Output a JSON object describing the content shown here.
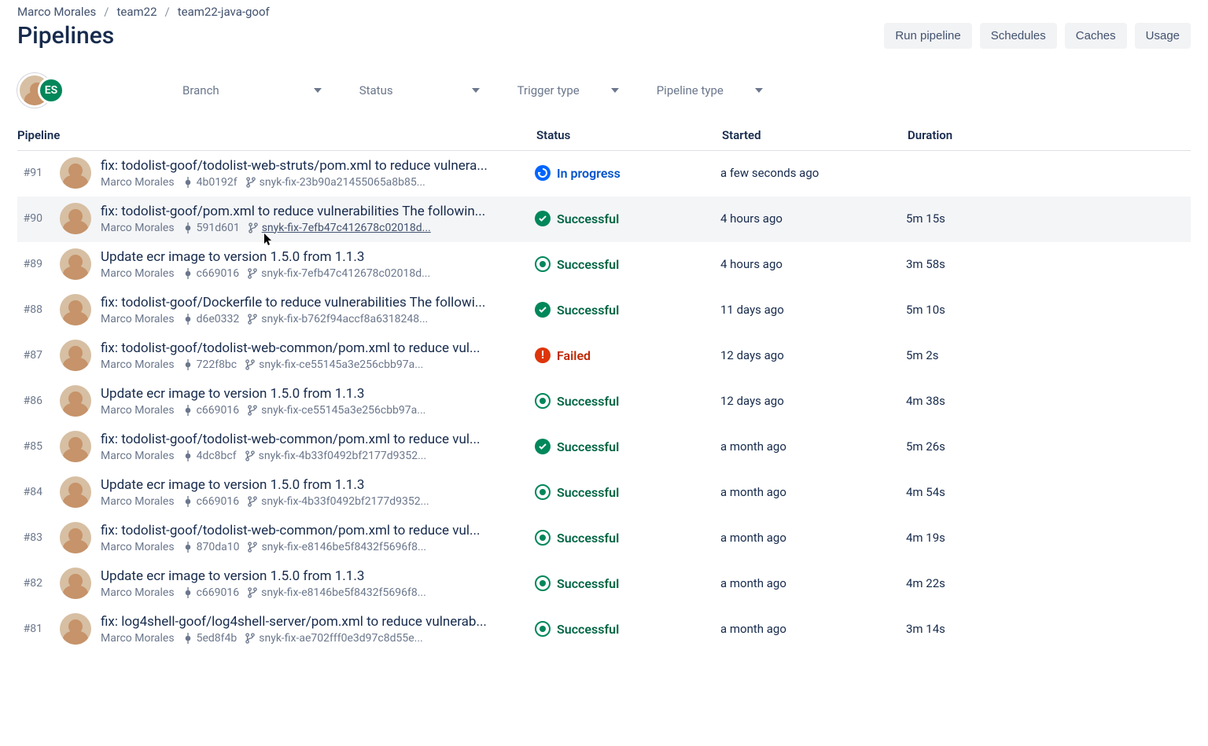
{
  "breadcrumbs": {
    "a": "Marco Morales",
    "b": "team22",
    "c": "team22-java-goof"
  },
  "page_title": "Pipelines",
  "header_actions": {
    "run": "Run pipeline",
    "schedules": "Schedules",
    "caches": "Caches",
    "usage": "Usage"
  },
  "filters": {
    "branch": "Branch",
    "status": "Status",
    "trigger": "Trigger type",
    "pipeline_type": "Pipeline type"
  },
  "avatar_badge": "ES",
  "columns": {
    "pipeline": "Pipeline",
    "status": "Status",
    "started": "Started",
    "duration": "Duration"
  },
  "status_labels": {
    "in_progress": "In progress",
    "successful": "Successful",
    "failed": "Failed"
  },
  "rows": [
    {
      "num": "#91",
      "title": "fix: todolist-goof/todolist-web-struts/pom.xml to reduce vulnera...",
      "author": "Marco Morales",
      "commit": "4b0192f",
      "branch": "snyk-fix-23b90a21455065a8b85...",
      "status": "in_progress",
      "status_style": "prog",
      "started": "a few seconds ago",
      "duration": ""
    },
    {
      "num": "#90",
      "title": "fix: todolist-goof/pom.xml to reduce vulnerabilities The followin...",
      "author": "Marco Morales",
      "commit": "591d601",
      "branch": " snyk-fix-7efb47c412678c02018d...",
      "branch_linked": true,
      "status": "successful",
      "status_style": "filled",
      "started": "4 hours ago",
      "duration": "5m 15s",
      "hovered": true
    },
    {
      "num": "#89",
      "title": "Update ecr image to version 1.5.0 from 1.1.3",
      "author": "Marco Morales",
      "commit": "c669016",
      "branch": "snyk-fix-7efb47c412678c02018d...",
      "status": "successful",
      "status_style": "ring",
      "started": "4 hours ago",
      "duration": "3m 58s"
    },
    {
      "num": "#88",
      "title": "fix: todolist-goof/Dockerfile to reduce vulnerabilities The followi...",
      "author": "Marco Morales",
      "commit": "d6e0332",
      "branch": "snyk-fix-b762f94accf8a6318248...",
      "status": "successful",
      "status_style": "filled",
      "started": "11 days ago",
      "duration": "5m 10s"
    },
    {
      "num": "#87",
      "title": "fix: todolist-goof/todolist-web-common/pom.xml to reduce vul...",
      "author": "Marco Morales",
      "commit": "722f8bc",
      "branch": "snyk-fix-ce55145a3e256cbb97a...",
      "status": "failed",
      "status_style": "fail",
      "started": "12 days ago",
      "duration": "5m 2s"
    },
    {
      "num": "#86",
      "title": "Update ecr image to version 1.5.0 from 1.1.3",
      "author": "Marco Morales",
      "commit": "c669016",
      "branch": "snyk-fix-ce55145a3e256cbb97a...",
      "status": "successful",
      "status_style": "ring",
      "started": "12 days ago",
      "duration": "4m 38s"
    },
    {
      "num": "#85",
      "title": "fix: todolist-goof/todolist-web-common/pom.xml to reduce vul...",
      "author": "Marco Morales",
      "commit": "4dc8bcf",
      "branch": "snyk-fix-4b33f0492bf2177d9352...",
      "status": "successful",
      "status_style": "filled",
      "started": "a month ago",
      "duration": "5m 26s"
    },
    {
      "num": "#84",
      "title": "Update ecr image to version 1.5.0 from 1.1.3",
      "author": "Marco Morales",
      "commit": "c669016",
      "branch": "snyk-fix-4b33f0492bf2177d9352...",
      "status": "successful",
      "status_style": "ring",
      "started": "a month ago",
      "duration": "4m 54s"
    },
    {
      "num": "#83",
      "title": "fix: todolist-goof/todolist-web-common/pom.xml to reduce vul...",
      "author": "Marco Morales",
      "commit": "870da10",
      "branch": "snyk-fix-e8146be5f8432f5696f8...",
      "status": "successful",
      "status_style": "ring",
      "started": "a month ago",
      "duration": "4m 19s"
    },
    {
      "num": "#82",
      "title": "Update ecr image to version 1.5.0 from 1.1.3",
      "author": "Marco Morales",
      "commit": "c669016",
      "branch": "snyk-fix-e8146be5f8432f5696f8...",
      "status": "successful",
      "status_style": "ring",
      "started": "a month ago",
      "duration": "4m 22s"
    },
    {
      "num": "#81",
      "title": "fix: log4shell-goof/log4shell-server/pom.xml to reduce vulnerab...",
      "author": "Marco Morales",
      "commit": "5ed8f4b",
      "branch": "snyk-fix-ae702fff0e3d97c8d55e...",
      "status": "successful",
      "status_style": "ring",
      "started": "a month ago",
      "duration": "3m 14s"
    }
  ]
}
